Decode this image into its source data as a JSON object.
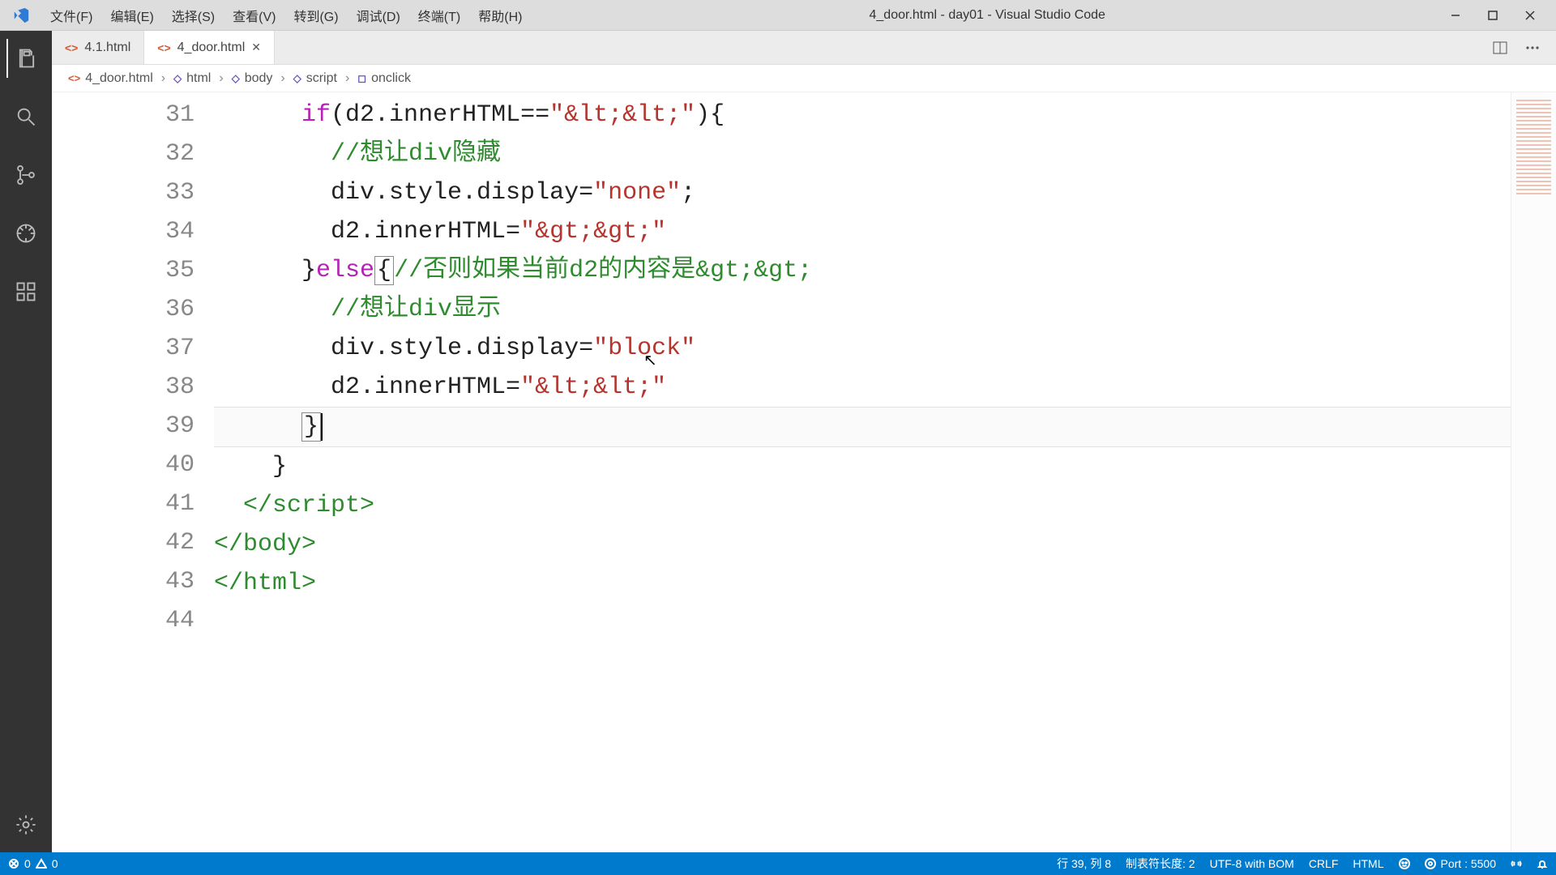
{
  "menubar": {
    "items": [
      {
        "label": "文件(F)"
      },
      {
        "label": "编辑(E)"
      },
      {
        "label": "选择(S)"
      },
      {
        "label": "查看(V)"
      },
      {
        "label": "转到(G)"
      },
      {
        "label": "调试(D)"
      },
      {
        "label": "终端(T)"
      },
      {
        "label": "帮助(H)"
      }
    ]
  },
  "window": {
    "title": "4_door.html - day01 - Visual Studio Code"
  },
  "tabs": [
    {
      "label": "4.1.html",
      "active": false,
      "dirty": false
    },
    {
      "label": "4_door.html",
      "active": true,
      "dirty": false
    }
  ],
  "breadcrumbs": [
    {
      "label": "4_door.html",
      "kind": "file"
    },
    {
      "label": "html",
      "kind": "tag"
    },
    {
      "label": "body",
      "kind": "tag"
    },
    {
      "label": "script",
      "kind": "tag"
    },
    {
      "label": "onclick",
      "kind": "symbol"
    }
  ],
  "gutter_start": 31,
  "gutter_count": 14,
  "code_lines": [
    {
      "n": 31,
      "html": "      <span class='c-keyword'>if</span>(d2.innerHTML==<span class='c-string'>\"&amp;lt;&amp;lt;\"</span>){"
    },
    {
      "n": 32,
      "html": "        <span class='c-comment'>//想让div隐藏</span>"
    },
    {
      "n": 33,
      "html": "        div.style.display=<span class='c-string'>\"none\"</span>;"
    },
    {
      "n": 34,
      "html": "        d2.innerHTML=<span class='c-string'>\"&amp;gt;&amp;gt;\"</span>"
    },
    {
      "n": 35,
      "html": "      }<span class='c-keyword'>else</span><span class='c-bracket'>{</span><span class='c-comment'>//否则如果当前d2的内容是&amp;gt;&amp;gt;</span>"
    },
    {
      "n": 36,
      "html": "        <span class='c-comment'>//想让div显示</span>"
    },
    {
      "n": 37,
      "html": "        div.style.display=<span class='c-string'>\"block\"</span>"
    },
    {
      "n": 38,
      "html": "        d2.innerHTML=<span class='c-string'>\"&amp;lt;&amp;lt;\"</span>"
    },
    {
      "n": 39,
      "html": "      <span class='c-bracket'>}</span><span class='cursor'></span>",
      "current": true
    },
    {
      "n": 40,
      "html": "    }"
    },
    {
      "n": 41,
      "html": "  <span class='c-tag'>&lt;/script&gt;</span>"
    },
    {
      "n": 42,
      "html": "<span class='c-tag'>&lt;/body&gt;</span>"
    },
    {
      "n": 43,
      "html": "<span class='c-tag'>&lt;/html&gt;</span>"
    },
    {
      "n": 44,
      "html": ""
    }
  ],
  "status": {
    "errors": "0",
    "warnings": "0",
    "cursor": "行 39, 列 8",
    "tab": "制表符长度: 2",
    "encoding": "UTF-8 with BOM",
    "eol": "CRLF",
    "language": "HTML",
    "port": "Port : 5500"
  }
}
